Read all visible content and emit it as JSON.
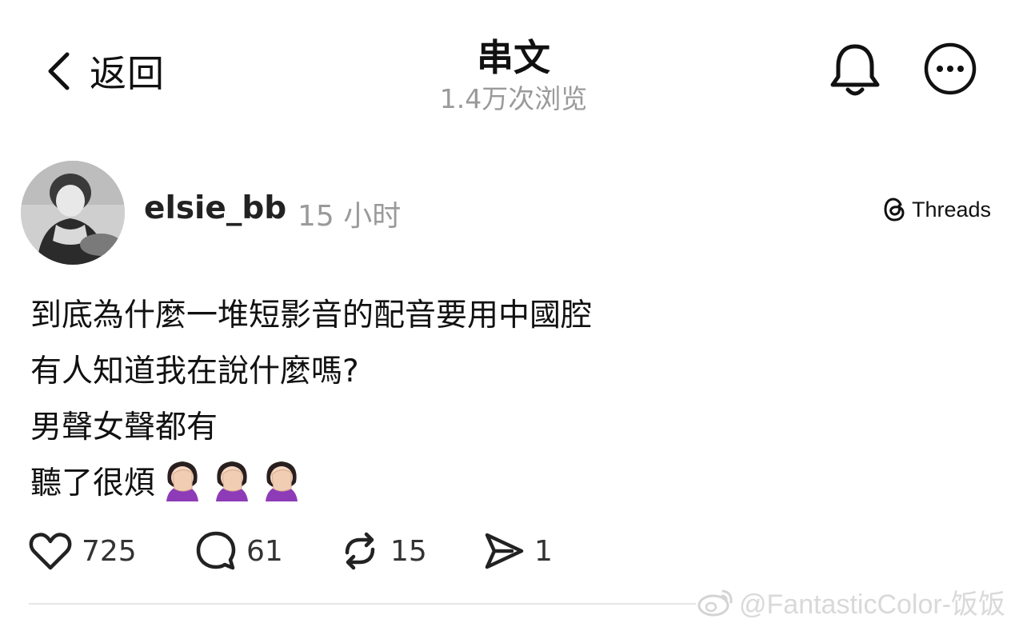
{
  "header": {
    "back_label": "返回",
    "title": "串文",
    "views": "1.4万次浏览"
  },
  "post": {
    "author": "elsie_bb",
    "time": "15 小时",
    "platform": "Threads",
    "lines": [
      "到底為什麼一堆短影音的配音要用中國腔",
      "有人知道我在說什麼嗎?",
      "男聲女聲都有",
      "聽了很煩"
    ],
    "emoji_count": 3
  },
  "actions": {
    "likes": "725",
    "comments": "61",
    "reposts": "15",
    "shares": "1"
  },
  "watermark": "@FantasticColor-饭饭",
  "colors": {
    "text": "#111111",
    "muted": "#9a9a9a",
    "divider": "#e6e6e6"
  }
}
